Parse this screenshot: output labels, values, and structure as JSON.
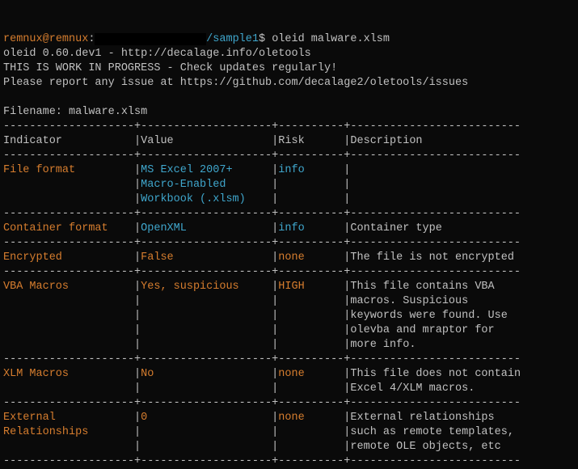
{
  "prompt": {
    "user": "remnux",
    "at": "@",
    "host": "remnux",
    "colon": ":",
    "redacted": "                 ",
    "path": "/sample1",
    "dollar": "$ ",
    "command": "oleid malware.xlsm"
  },
  "header": {
    "line1": "oleid 0.60.dev1 - http://decalage.info/oletools",
    "line2": "THIS IS WORK IN PROGRESS - Check updates regularly!",
    "line3": "Please report any issue at https://github.com/decalage2/oletools/issues",
    "blank": "",
    "filename": "Filename: malware.xlsm"
  },
  "sep_lines": {
    "top1": "--------------------+--------------------+----------+--------------------------",
    "top2": "--------------------+--------------------+----------+--------------------------",
    "r1": "--------------------+--------------------+----------+--------------------------",
    "r2": "--------------------+--------------------+----------+--------------------------",
    "r3": "--------------------+--------------------+----------+--------------------------",
    "r4": "--------------------+--------------------+----------+--------------------------",
    "r5": "--------------------+--------------------+----------+--------------------------",
    "r6": "--------------------+--------------------+----------+--------------------------"
  },
  "cols": {
    "c1": "Indicator           ",
    "c2": "Value               ",
    "c3": "Risk      ",
    "c4": "Description"
  },
  "rows": {
    "file_format": {
      "l1": {
        "ind": "File format         ",
        "val": "MS Excel 2007+      ",
        "risk": "info      ",
        "desc": "                          "
      },
      "l2": {
        "ind": "                    ",
        "val": "Macro-Enabled       ",
        "risk": "          ",
        "desc": "                          "
      },
      "l3": {
        "ind": "                    ",
        "val": "Workbook (.xlsm)    ",
        "risk": "          ",
        "desc": "                          "
      }
    },
    "container": {
      "l1": {
        "ind": "Container format    ",
        "val": "OpenXML             ",
        "risk": "info      ",
        "desc": "Container type            "
      }
    },
    "encrypted": {
      "l1": {
        "ind": "Encrypted           ",
        "val": "False               ",
        "risk": "none      ",
        "desc": "The file is not encrypted "
      }
    },
    "vba": {
      "l1": {
        "ind": "VBA Macros          ",
        "val": "Yes, suspicious     ",
        "risk": "HIGH      ",
        "desc": "This file contains VBA    "
      },
      "l2": {
        "ind": "                    ",
        "val": "                    ",
        "risk": "          ",
        "desc": "macros. Suspicious        "
      },
      "l3": {
        "ind": "                    ",
        "val": "                    ",
        "risk": "          ",
        "desc": "keywords were found. Use  "
      },
      "l4": {
        "ind": "                    ",
        "val": "                    ",
        "risk": "          ",
        "desc": "olevba and mraptor for    "
      },
      "l5": {
        "ind": "                    ",
        "val": "                    ",
        "risk": "          ",
        "desc": "more info.                "
      }
    },
    "xlm": {
      "l1": {
        "ind": "XLM Macros          ",
        "val": "No                  ",
        "risk": "none      ",
        "desc": "This file does not contain"
      },
      "l2": {
        "ind": "                    ",
        "val": "                    ",
        "risk": "          ",
        "desc": "Excel 4/XLM macros.       "
      }
    },
    "ext": {
      "l1": {
        "ind": "External            ",
        "val": "0                   ",
        "risk": "none      ",
        "desc": "External relationships    "
      },
      "l2": {
        "ind": "Relationships       ",
        "val": "                    ",
        "risk": "          ",
        "desc": "such as remote templates, "
      },
      "l3": {
        "ind": "                    ",
        "val": "                    ",
        "risk": "          ",
        "desc": "remote OLE objects, etc   "
      }
    }
  },
  "pipe": "|"
}
